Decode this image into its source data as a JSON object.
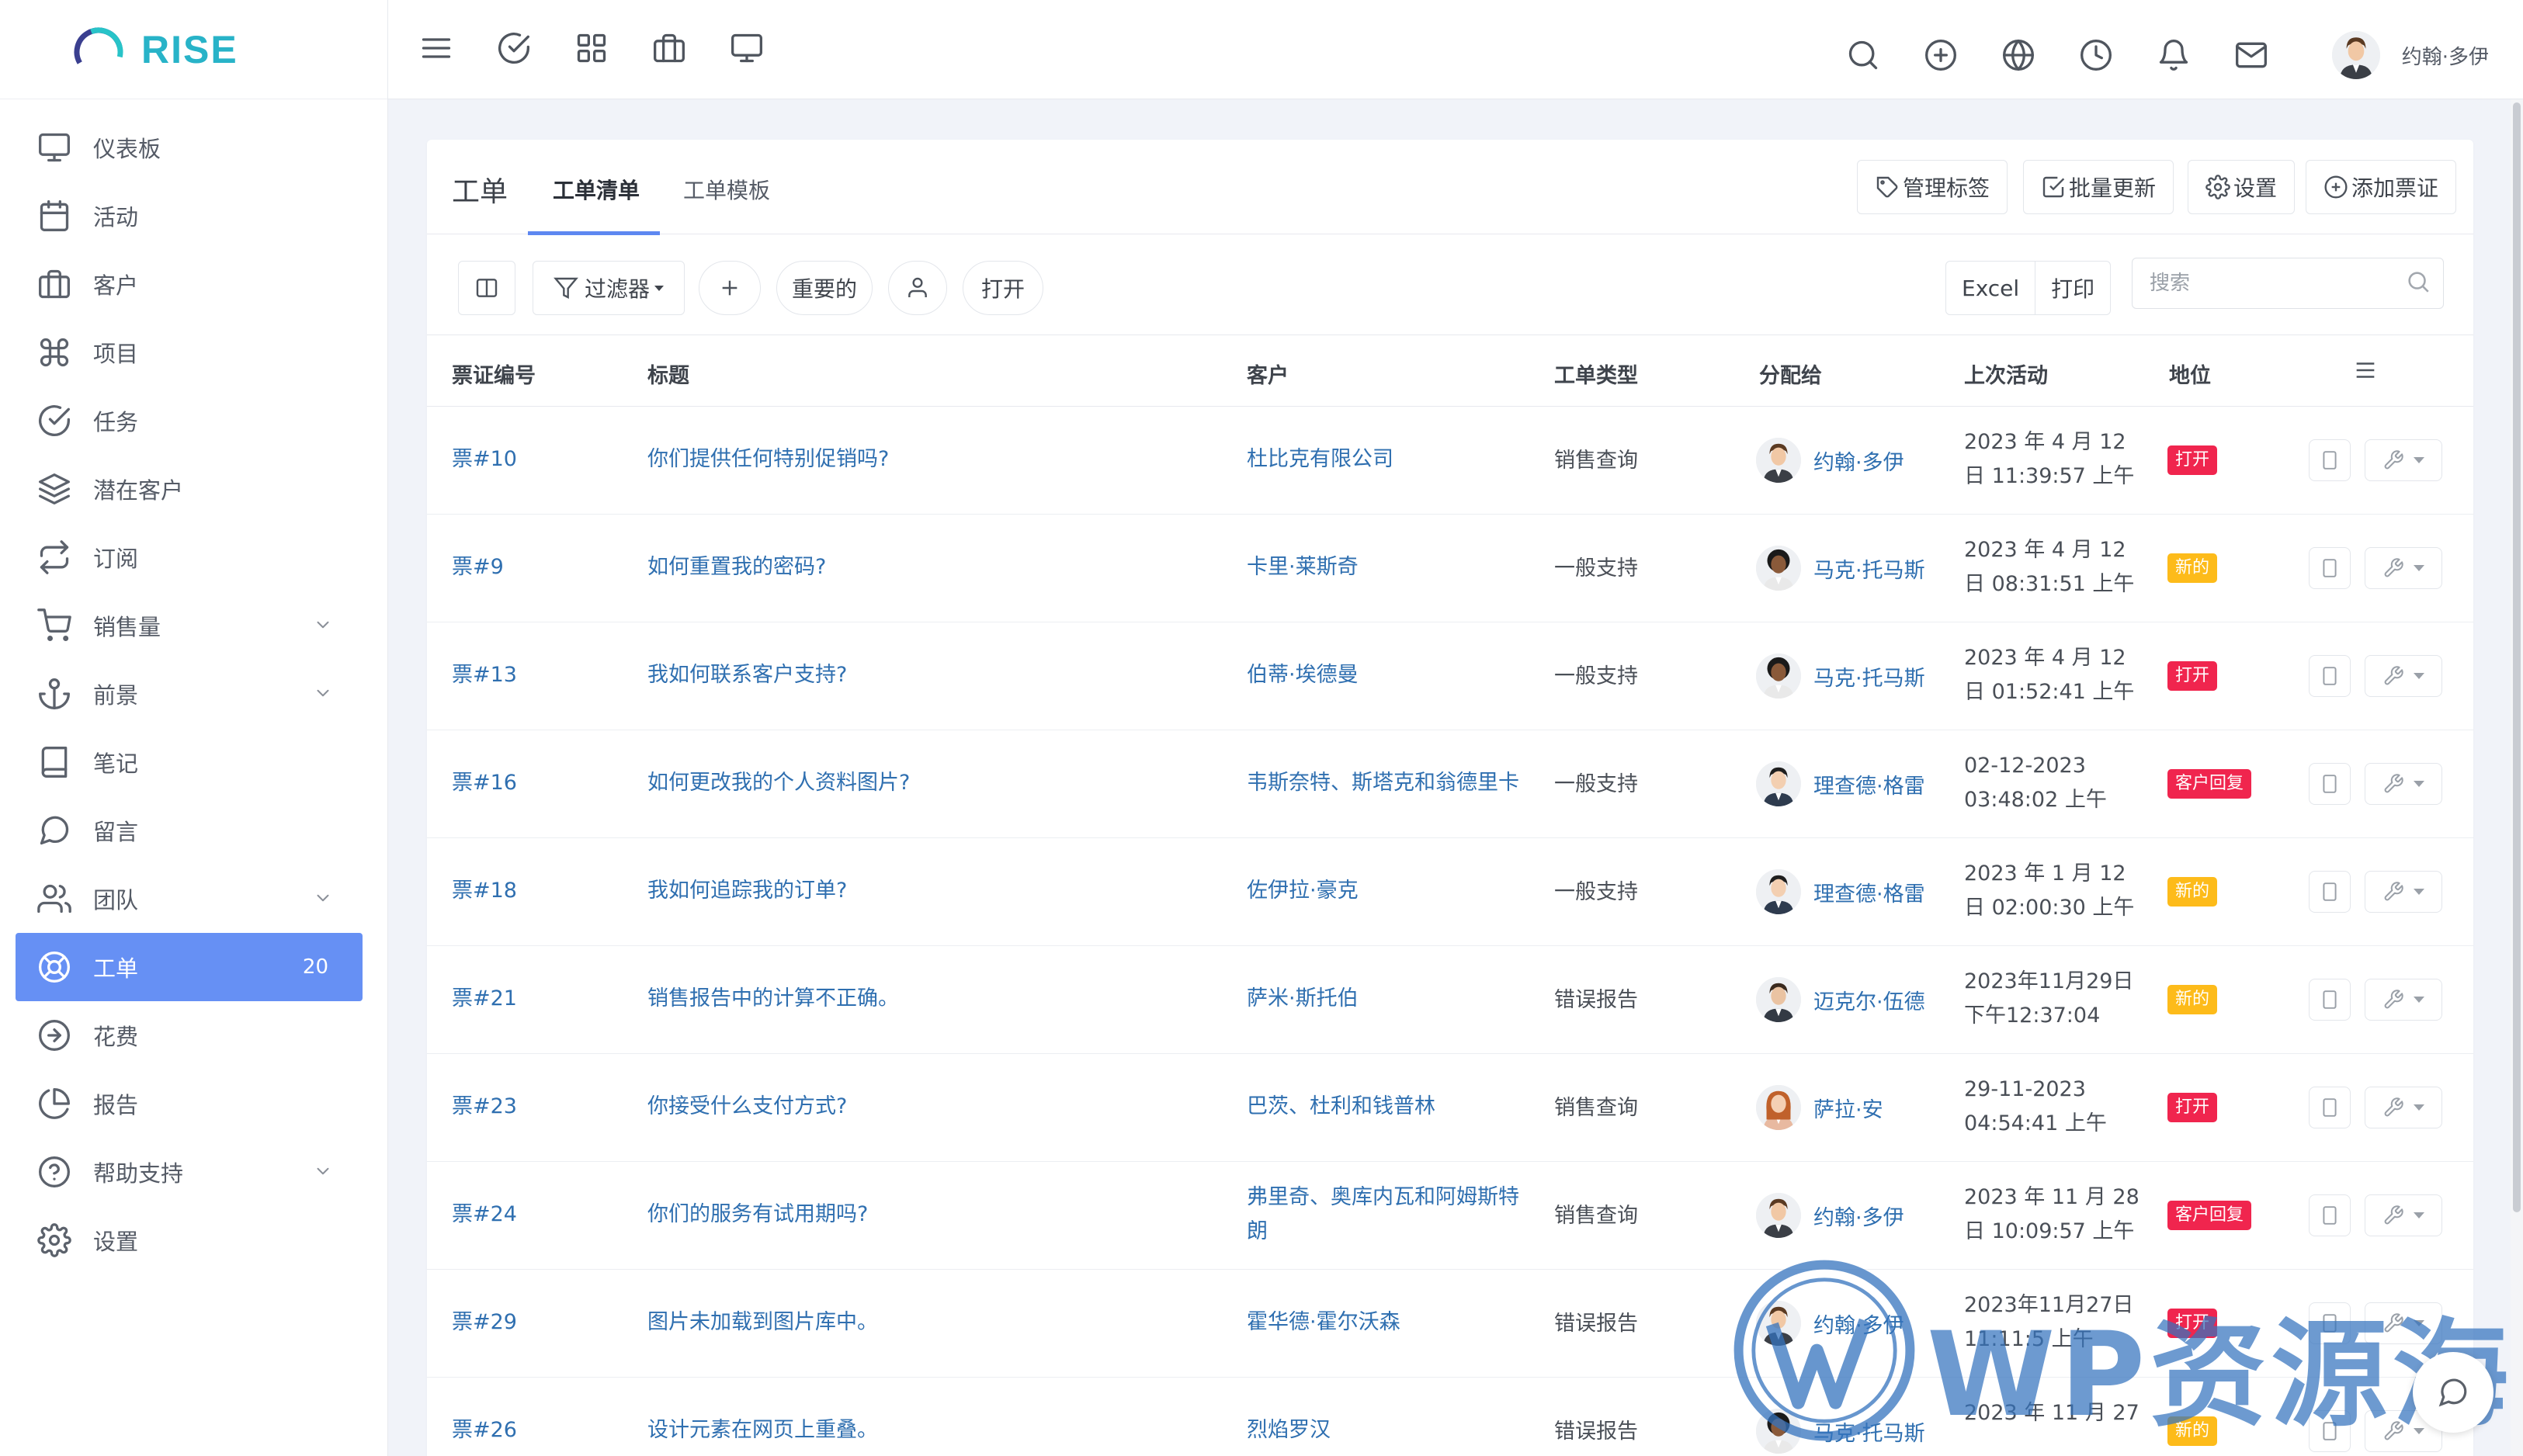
{
  "app": {
    "name": "RISE",
    "brand_color": "#28b3c8",
    "accent_color": "#6690f4"
  },
  "sidebar": {
    "items": [
      {
        "label": "仪表板",
        "icon": "monitor-icon"
      },
      {
        "label": "活动",
        "icon": "calendar-icon"
      },
      {
        "label": "客户",
        "icon": "briefcase-icon"
      },
      {
        "label": "项目",
        "icon": "command-icon"
      },
      {
        "label": "任务",
        "icon": "check-circle-icon"
      },
      {
        "label": "潜在客户",
        "icon": "layers-icon"
      },
      {
        "label": "订阅",
        "icon": "repeat-icon"
      },
      {
        "label": "销售量",
        "icon": "cart-icon",
        "has_submenu": true
      },
      {
        "label": "前景",
        "icon": "anchor-icon",
        "has_submenu": true
      },
      {
        "label": "笔记",
        "icon": "book-icon"
      },
      {
        "label": "留言",
        "icon": "message-circle-icon"
      },
      {
        "label": "团队",
        "icon": "users-icon",
        "has_submenu": true
      },
      {
        "label": "工单",
        "icon": "life-buoy-icon",
        "active": true,
        "count": "20"
      },
      {
        "label": "花费",
        "icon": "arrow-right-circle-icon"
      },
      {
        "label": "报告",
        "icon": "pie-chart-icon"
      },
      {
        "label": "帮助支持",
        "icon": "help-circle-icon",
        "has_submenu": true
      },
      {
        "label": "设置",
        "icon": "settings-icon"
      }
    ]
  },
  "topbar": {
    "left_icons": [
      "menu-icon",
      "check-circle-icon",
      "grid-icon",
      "briefcase-icon",
      "monitor-icon"
    ],
    "right_icons": [
      "search-icon",
      "plus-circle-icon",
      "globe-icon",
      "clock-icon",
      "bell-icon",
      "mail-icon"
    ],
    "user_name": "约翰·多伊"
  },
  "page": {
    "title": "工单",
    "tabs": [
      {
        "label": "工单清单",
        "active": true
      },
      {
        "label": "工单模板",
        "active": false
      }
    ],
    "header_buttons": {
      "manage_labels": "管理标签",
      "batch_update": "批量更新",
      "settings": "设置",
      "add_ticket": "添加票证"
    }
  },
  "toolbar": {
    "filter_label": "过滤器",
    "important_label": "重要的",
    "open_label": "打开",
    "excel_label": "Excel",
    "print_label": "打印",
    "search_placeholder": "搜索"
  },
  "table": {
    "columns": [
      "票证编号",
      "标题",
      "客户",
      "工单类型",
      "分配给",
      "上次活动",
      "地位"
    ],
    "rows": [
      {
        "id": "票#10",
        "title": "你们提供任何特别促销吗?",
        "client": "杜比克有限公司",
        "client2": "",
        "type": "销售查询",
        "assignee": "约翰·多伊",
        "avatar": "john",
        "activity1": "2023 年 4 月 12",
        "activity2": "日 11:39:57 上午",
        "status": "打开",
        "status_color": "red"
      },
      {
        "id": "票#9",
        "title": "如何重置我的密码?",
        "client": "卡里·莱斯奇",
        "client2": "",
        "type": "一般支持",
        "assignee": "马克·托马斯",
        "avatar": "mark",
        "activity1": "2023 年 4 月 12",
        "activity2": "日 08:31:51 上午",
        "status": "新的",
        "status_color": "yellow"
      },
      {
        "id": "票#13",
        "title": "我如何联系客户支持?",
        "client": "伯蒂·埃德曼",
        "client2": "",
        "type": "一般支持",
        "assignee": "马克·托马斯",
        "avatar": "mark",
        "activity1": "2023 年 4 月 12",
        "activity2": "日 01:52:41 上午",
        "status": "打开",
        "status_color": "red"
      },
      {
        "id": "票#16",
        "title": "如何更改我的个人资料图片?",
        "client": "韦斯奈特、斯塔克和翁德里卡",
        "client2": "",
        "type": "一般支持",
        "assignee": "理查德·格雷",
        "avatar": "richard",
        "activity1": "02-12-2023",
        "activity2": "03:48:02 上午",
        "status": "客户回复",
        "status_color": "red"
      },
      {
        "id": "票#18",
        "title": "我如何追踪我的订单?",
        "client": "佐伊拉·豪克",
        "client2": "",
        "type": "一般支持",
        "assignee": "理查德·格雷",
        "avatar": "richard",
        "activity1": "2023 年 1 月 12",
        "activity2": "日 02:00:30 上午",
        "status": "新的",
        "status_color": "yellow"
      },
      {
        "id": "票#21",
        "title": "销售报告中的计算不正确。",
        "client": "萨米·斯托伯",
        "client2": "",
        "type": "错误报告",
        "assignee": "迈克尔·伍德",
        "avatar": "michael",
        "activity1": "2023年11月29日",
        "activity2": "下午12:37:04",
        "status": "新的",
        "status_color": "yellow"
      },
      {
        "id": "票#23",
        "title": "你接受什么支付方式?",
        "client": "巴茨、杜利和钱普林",
        "client2": "",
        "type": "销售查询",
        "assignee": "萨拉·安",
        "avatar": "sara",
        "activity1": "29-11-2023",
        "activity2": "04:54:41 上午",
        "status": "打开",
        "status_color": "red"
      },
      {
        "id": "票#24",
        "title": "你们的服务有试用期吗?",
        "client": "弗里奇、奥库内瓦和阿姆斯特",
        "client2": "朗",
        "type": "销售查询",
        "assignee": "约翰·多伊",
        "avatar": "john",
        "activity1": "2023 年 11 月 28",
        "activity2": "日 10:09:57 上午",
        "status": "客户回复",
        "status_color": "red"
      },
      {
        "id": "票#29",
        "title": "图片未加载到图片库中。",
        "client": "霍华德·霍尔沃森",
        "client2": "",
        "type": "错误报告",
        "assignee": "约翰·多伊",
        "avatar": "john",
        "activity1": "2023年11月27日",
        "activity2": "11:11:5 上午",
        "status": "打开",
        "status_color": "red"
      },
      {
        "id": "票#26",
        "title": "设计元素在网页上重叠。",
        "client": "烈焰罗汉",
        "client2": "",
        "type": "错误报告",
        "assignee": "马克·托马斯",
        "avatar": "mark",
        "activity1": "2023 年 11 月 27",
        "activity2": "",
        "status": "新的",
        "status_color": "yellow"
      }
    ]
  },
  "watermark": {
    "text": "WP资源海"
  }
}
